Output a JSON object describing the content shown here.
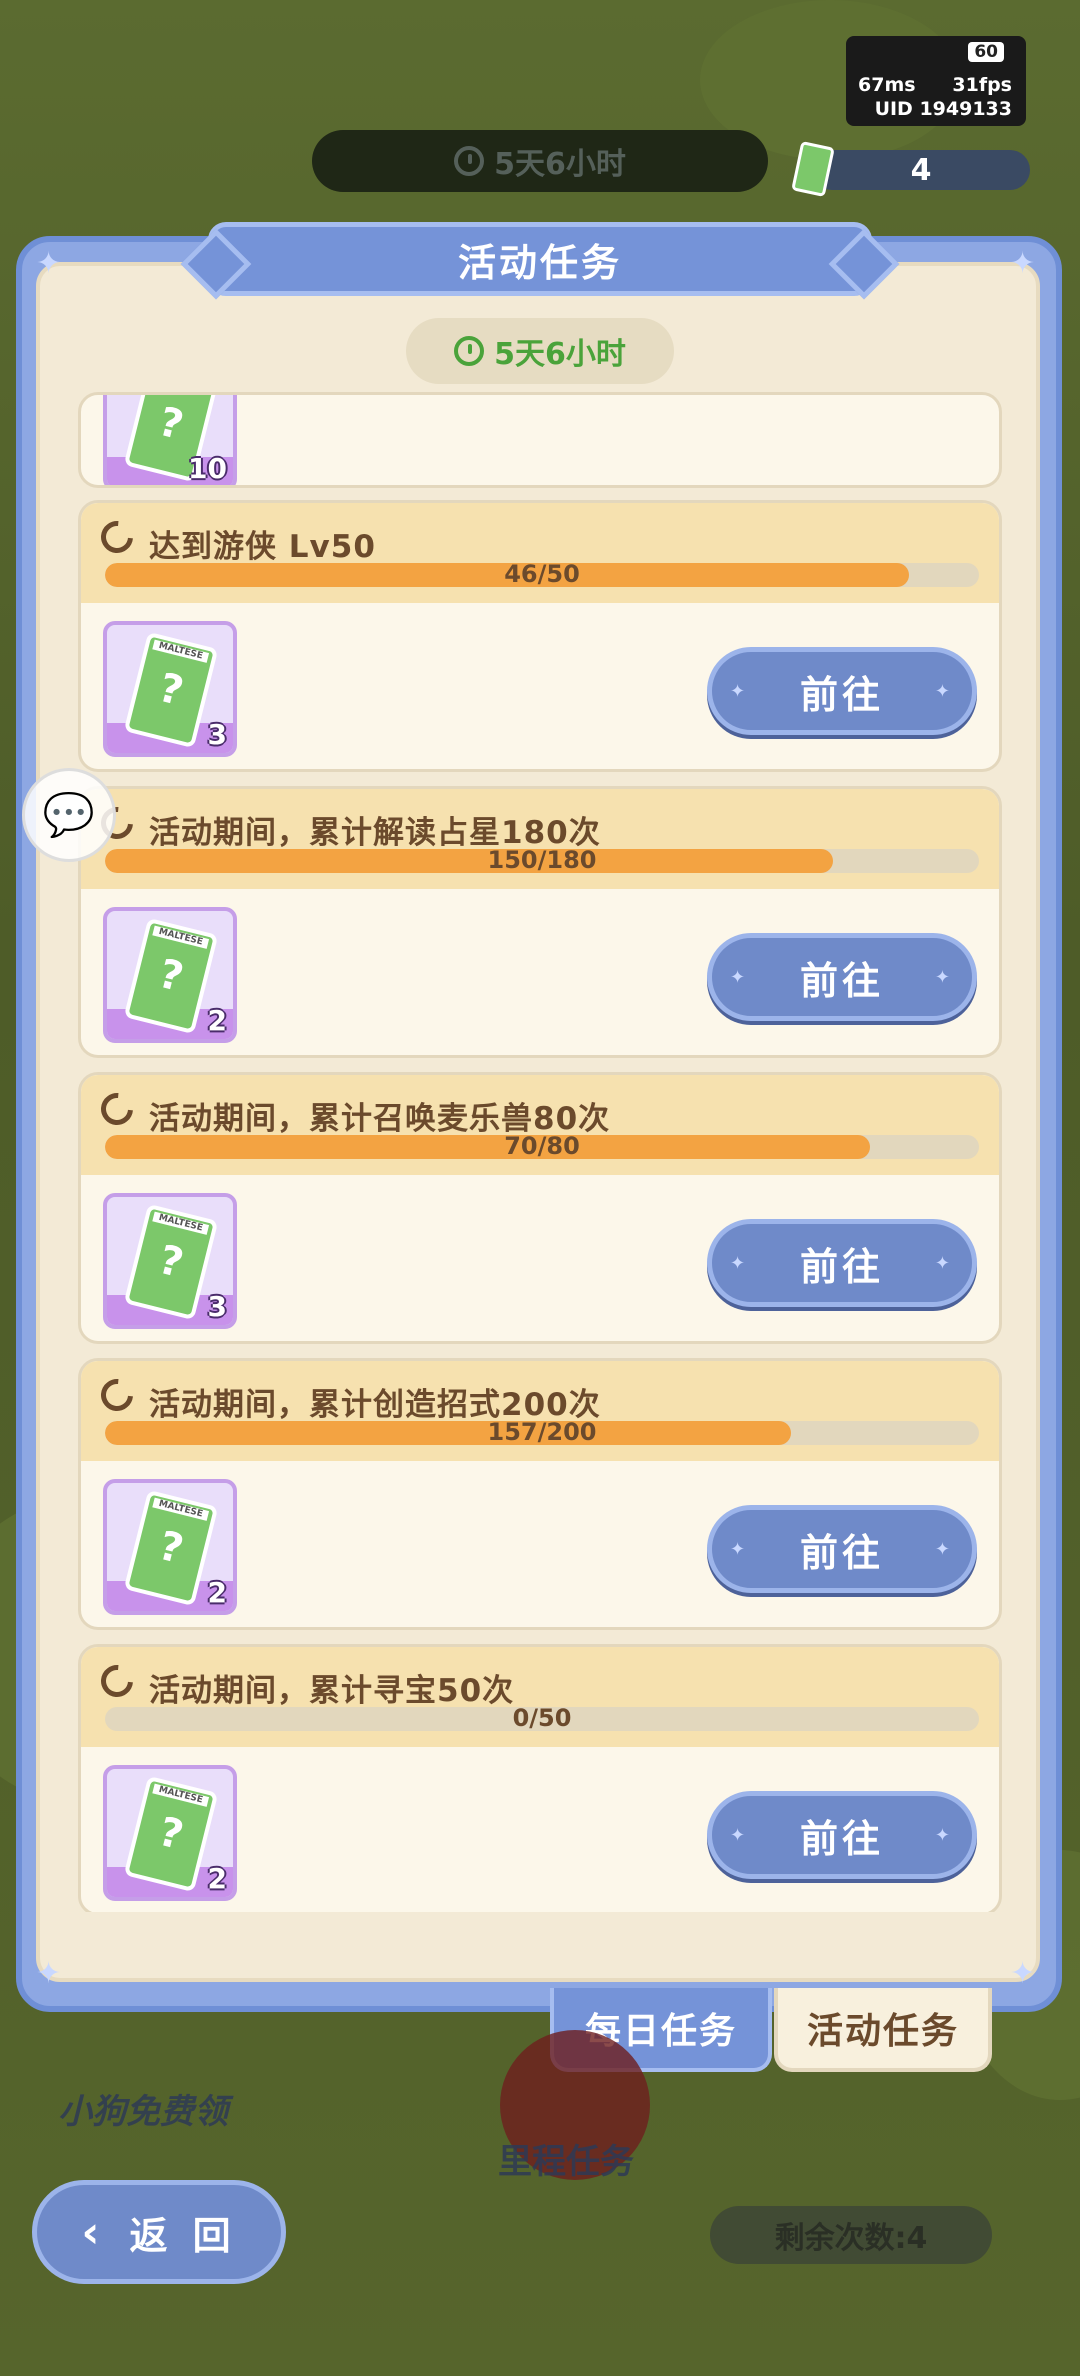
{
  "hud": {
    "timer": "5天6小时",
    "fps_badge": "60",
    "ping": "67ms",
    "fps": "31fps",
    "uid": "UID 1949133",
    "ticket_count": "4"
  },
  "panel": {
    "title": "活动任务",
    "timer": "5天6小时"
  },
  "partial_task": {
    "reward_count": "10"
  },
  "tasks": [
    {
      "title": "达到游侠  Lv50",
      "progress_text": "46/50",
      "progress": 0.92,
      "reward_count": "3",
      "button": "前往"
    },
    {
      "title": "活动期间，累计解读占星180次",
      "progress_text": "150/180",
      "progress": 0.833,
      "reward_count": "2",
      "button": "前往"
    },
    {
      "title": "活动期间，累计召唤麦乐兽80次",
      "progress_text": "70/80",
      "progress": 0.875,
      "reward_count": "3",
      "button": "前往"
    },
    {
      "title": "活动期间，累计创造招式200次",
      "progress_text": "157/200",
      "progress": 0.785,
      "reward_count": "2",
      "button": "前往"
    },
    {
      "title": "活动期间，累计寻宝50次",
      "progress_text": "0/50",
      "progress": 0,
      "reward_count": "2",
      "button": "前往"
    }
  ],
  "tabs": {
    "daily": "每日任务",
    "event": "活动任务"
  },
  "scene": {
    "free_dog": "小狗免费领",
    "mileage": "里程任务",
    "remaining": "剩余次数:4"
  },
  "back_button": "返 回",
  "card_label": "MALTESE",
  "colors": {
    "accent": "#7593d8",
    "progress": "#f3a342",
    "card_header": "#f6e1af"
  }
}
